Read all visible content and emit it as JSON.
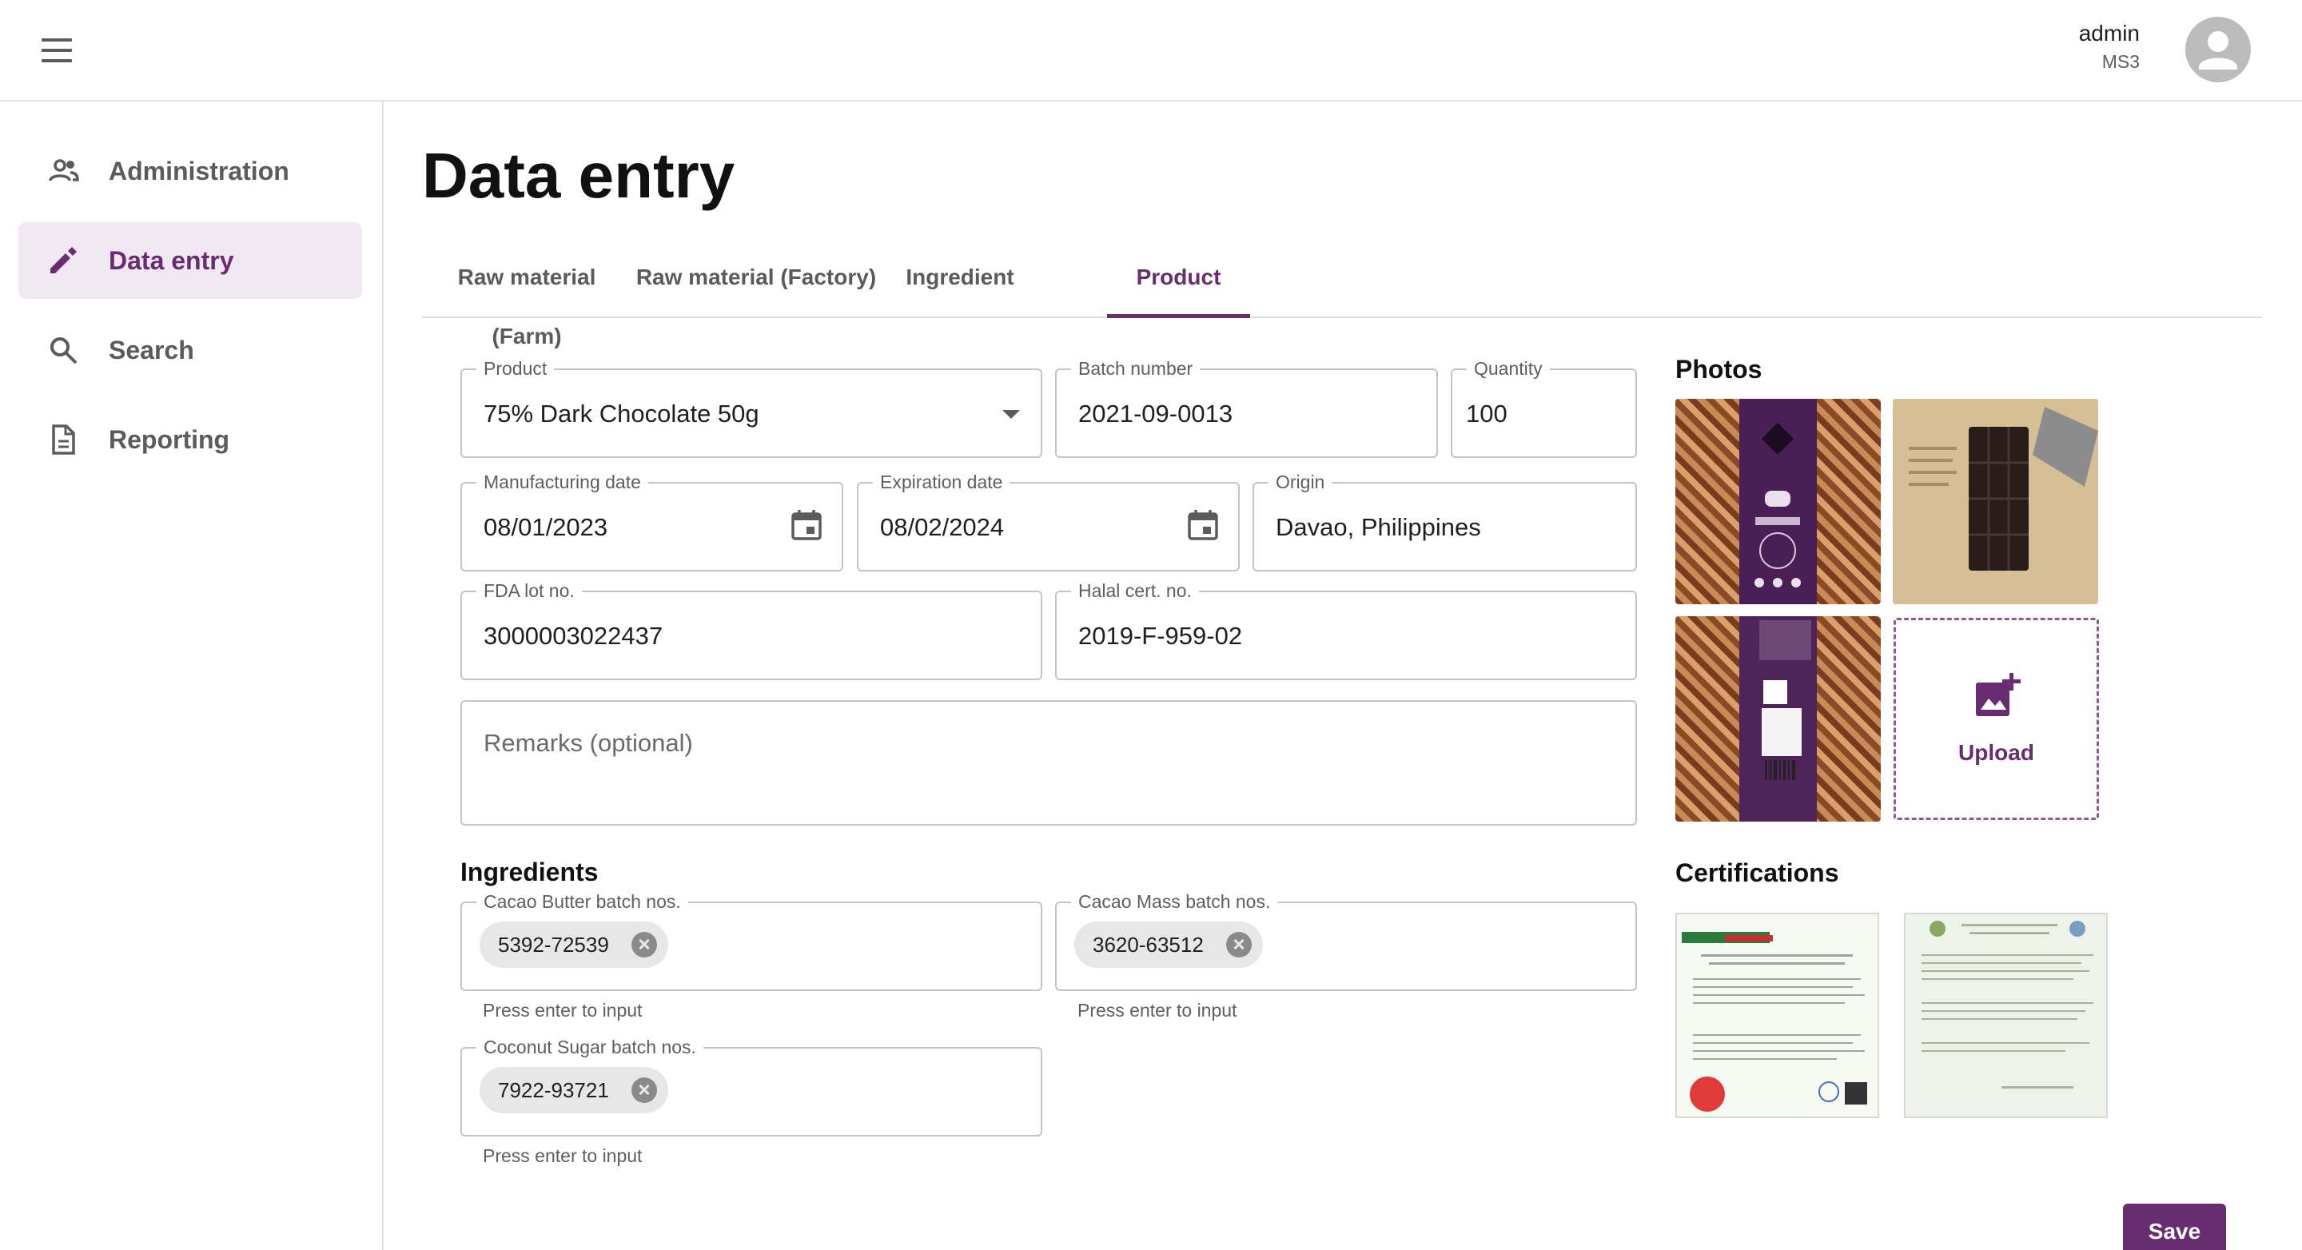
{
  "header": {
    "user_name": "admin",
    "user_org": "MS3"
  },
  "sidebar": {
    "items": [
      {
        "label": "Administration",
        "icon": "people-icon"
      },
      {
        "label": "Data entry",
        "icon": "pencil-icon",
        "active": true
      },
      {
        "label": "Search",
        "icon": "search-icon"
      },
      {
        "label": "Reporting",
        "icon": "document-icon"
      }
    ]
  },
  "page": {
    "title": "Data entry"
  },
  "tabs": [
    {
      "label": "Raw material (Farm)"
    },
    {
      "label": "Raw material (Factory)"
    },
    {
      "label": "Ingredient"
    },
    {
      "label": "Product",
      "active": true
    }
  ],
  "form": {
    "product": {
      "label": "Product",
      "value": "75% Dark Chocolate 50g"
    },
    "batch_number": {
      "label": "Batch number",
      "value": "2021-09-0013"
    },
    "quantity": {
      "label": "Quantity",
      "value": "100"
    },
    "manufacturing_date": {
      "label": "Manufacturing date",
      "value": "08/01/2023"
    },
    "expiration_date": {
      "label": "Expiration date",
      "value": "08/02/2024"
    },
    "origin": {
      "label": "Origin",
      "value": "Davao, Philippines"
    },
    "fda_lot": {
      "label": "FDA lot no.",
      "value": "3000003022437"
    },
    "halal_cert": {
      "label": "Halal cert. no.",
      "value": "2019-F-959-02"
    },
    "remarks": {
      "placeholder": "Remarks (optional)"
    }
  },
  "ingredients": {
    "heading": "Ingredients",
    "helper": "Press enter to input",
    "fields": [
      {
        "label": "Cacao Butter batch nos.",
        "chips": [
          "5392-72539"
        ]
      },
      {
        "label": "Cacao Mass batch nos.",
        "chips": [
          "3620-63512"
        ]
      },
      {
        "label": "Coconut Sugar batch nos.",
        "chips": [
          "7922-93721"
        ]
      }
    ]
  },
  "photos": {
    "heading": "Photos",
    "upload_label": "Upload"
  },
  "certifications": {
    "heading": "Certifications"
  },
  "actions": {
    "save_label": "Save"
  },
  "colors": {
    "accent": "#6a2c70",
    "active_nav_bg": "#f2e8f4"
  }
}
